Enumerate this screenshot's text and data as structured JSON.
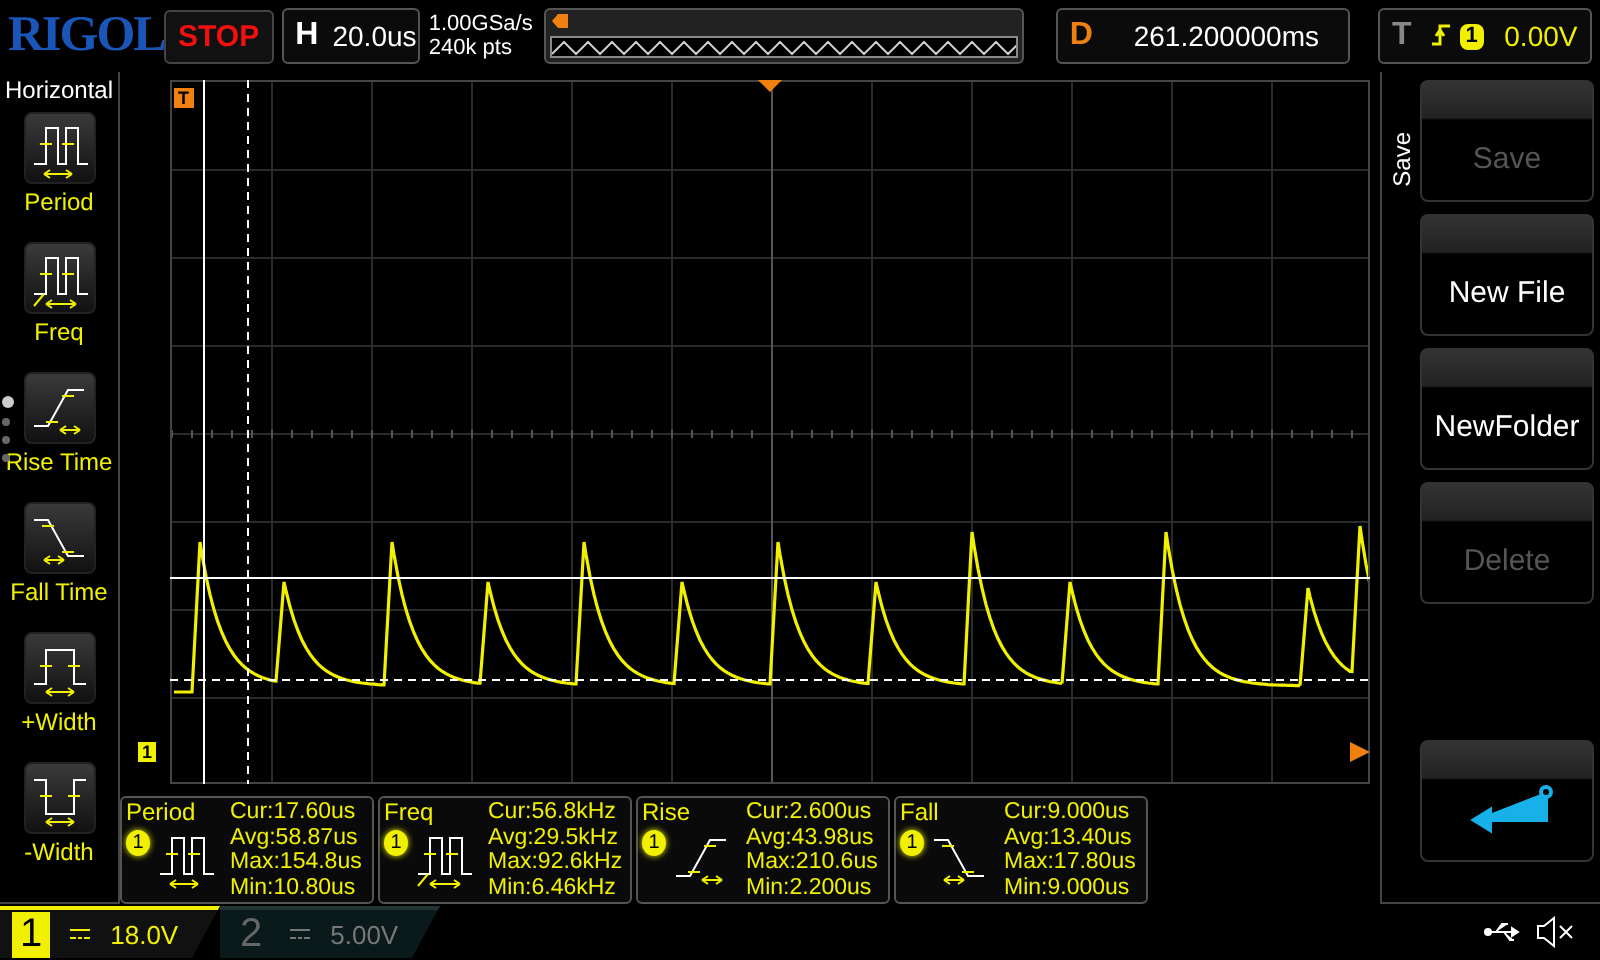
{
  "brand": "RIGOL",
  "run_status": "STOP",
  "horizontal": {
    "label": "H",
    "timebase": "20.0us",
    "sample_rate": "1.00GSa/s",
    "memory_depth": "240k pts"
  },
  "delay": {
    "label": "D",
    "value": "261.200000ms"
  },
  "trigger": {
    "label": "T",
    "channel": "1",
    "level": "0.00V"
  },
  "left_menu": {
    "title": "Horizontal",
    "pages": [
      {
        "selected": true
      },
      {
        "selected": false
      },
      {
        "selected": false
      },
      {
        "selected": false
      }
    ],
    "items": [
      {
        "kind": "period",
        "label": "Period"
      },
      {
        "kind": "freq",
        "label": "Freq"
      },
      {
        "kind": "rise",
        "label": "Rise Time"
      },
      {
        "kind": "fall",
        "label": "Fall Time"
      },
      {
        "kind": "pwidth",
        "label": "+Width"
      },
      {
        "kind": "nwidth",
        "label": "-Width"
      }
    ]
  },
  "graph": {
    "trigger_marker": "T",
    "channel_marker": "1"
  },
  "measurements": [
    {
      "kind": "period",
      "name": "Period",
      "channel": "1",
      "lines": [
        "Cur:17.60us",
        "Avg:58.87us",
        "Max:154.8us",
        "Min:10.80us"
      ]
    },
    {
      "kind": "freq",
      "name": "Freq",
      "channel": "1",
      "lines": [
        "Cur:56.8kHz",
        "Avg:29.5kHz",
        "Max:92.6kHz",
        "Min:6.46kHz"
      ]
    },
    {
      "kind": "rise",
      "name": "Rise",
      "channel": "1",
      "lines": [
        "Cur:2.600us",
        "Avg:43.98us",
        "Max:210.6us",
        "Min:2.200us"
      ]
    },
    {
      "kind": "fall",
      "name": "Fall",
      "channel": "1",
      "lines": [
        "Cur:9.000us",
        "Avg:13.40us",
        "Max:17.80us",
        "Min:9.000us"
      ]
    }
  ],
  "right_menu": {
    "title": "Save",
    "buttons": [
      {
        "kind": "text",
        "label": "Save",
        "disabled": true
      },
      {
        "kind": "text",
        "label": "New File",
        "disabled": false
      },
      {
        "kind": "text",
        "label": "NewFolder",
        "disabled": false
      },
      {
        "kind": "text",
        "label": "Delete",
        "disabled": true
      },
      {
        "kind": "return",
        "disabled": false
      }
    ]
  },
  "channels": [
    {
      "number": "1",
      "scale": "18.0V",
      "active": true
    },
    {
      "number": "2",
      "scale": "5.00V",
      "active": false
    }
  ]
}
